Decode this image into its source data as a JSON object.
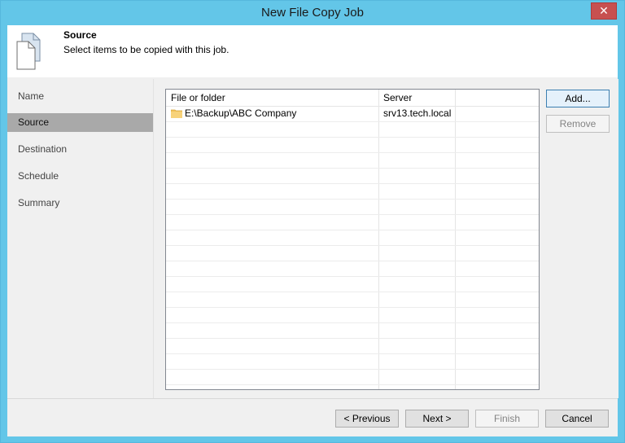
{
  "window": {
    "title": "New File Copy Job",
    "close_glyph": "✕"
  },
  "header": {
    "title": "Source",
    "description": "Select items to be copied with this job."
  },
  "nav": {
    "items": [
      {
        "label": "Name"
      },
      {
        "label": "Source",
        "active": true
      },
      {
        "label": "Destination"
      },
      {
        "label": "Schedule"
      },
      {
        "label": "Summary"
      }
    ]
  },
  "grid": {
    "columns": [
      "File or folder",
      "Server",
      ""
    ],
    "rows": [
      {
        "icon": "folder-icon",
        "path": "E:\\Backup\\ABC Company",
        "server": "srv13.tech.local"
      }
    ]
  },
  "side_buttons": {
    "add": "Add...",
    "remove": "Remove"
  },
  "footer": {
    "previous": "< Previous",
    "next": "Next >",
    "finish": "Finish",
    "cancel": "Cancel"
  },
  "colors": {
    "title_bar": "#63c6e8",
    "selected_nav": "#a9a9a9",
    "folder": "#f2c35a"
  }
}
